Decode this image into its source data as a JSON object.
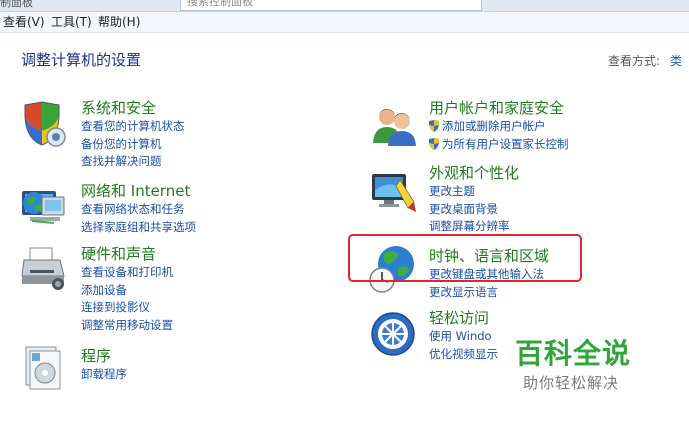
{
  "address_fragment": "制面板",
  "search_placeholder_fragment": "搜索控制面板",
  "menu": [
    "查看(V)",
    "工具(T)",
    "帮助(H)"
  ],
  "page_title": "调整计算机的设置",
  "view_by": {
    "label": "查看方式:",
    "value": "类"
  },
  "left_categories": [
    {
      "title": "系统和安全",
      "links": [
        "查看您的计算机状态",
        "备份您的计算机",
        "查找并解决问题"
      ]
    },
    {
      "title": "网络和 Internet",
      "links": [
        "查看网络状态和任务",
        "选择家庭组和共享选项"
      ]
    },
    {
      "title": "硬件和声音",
      "links": [
        "查看设备和打印机",
        "添加设备",
        "连接到投影仪",
        "调整常用移动设置"
      ]
    },
    {
      "title": "程序",
      "links": [
        "卸载程序"
      ]
    }
  ],
  "right_categories": [
    {
      "title": "用户帐户和家庭安全",
      "links": [
        "添加或删除用户帐户",
        "为所有用户设置家长控制"
      ]
    },
    {
      "title": "外观和个性化",
      "links": [
        "更改主题",
        "更改桌面背景",
        "调整屏幕分辨率"
      ]
    },
    {
      "title": "时钟、语言和区域",
      "links": [
        "更改键盘或其他输入法",
        "更改显示语言"
      ]
    },
    {
      "title": "轻松访问",
      "links": [
        "使用 Windo",
        "优化视频显示"
      ]
    }
  ],
  "watermark": {
    "title": "百科全说",
    "subtitle": "助你轻松解决"
  },
  "colors": {
    "title_green": "#1e7d1e",
    "link_blue": "#1b4fa8",
    "highlight_red": "#e0252c",
    "watermark_green": "#2fa53a"
  }
}
